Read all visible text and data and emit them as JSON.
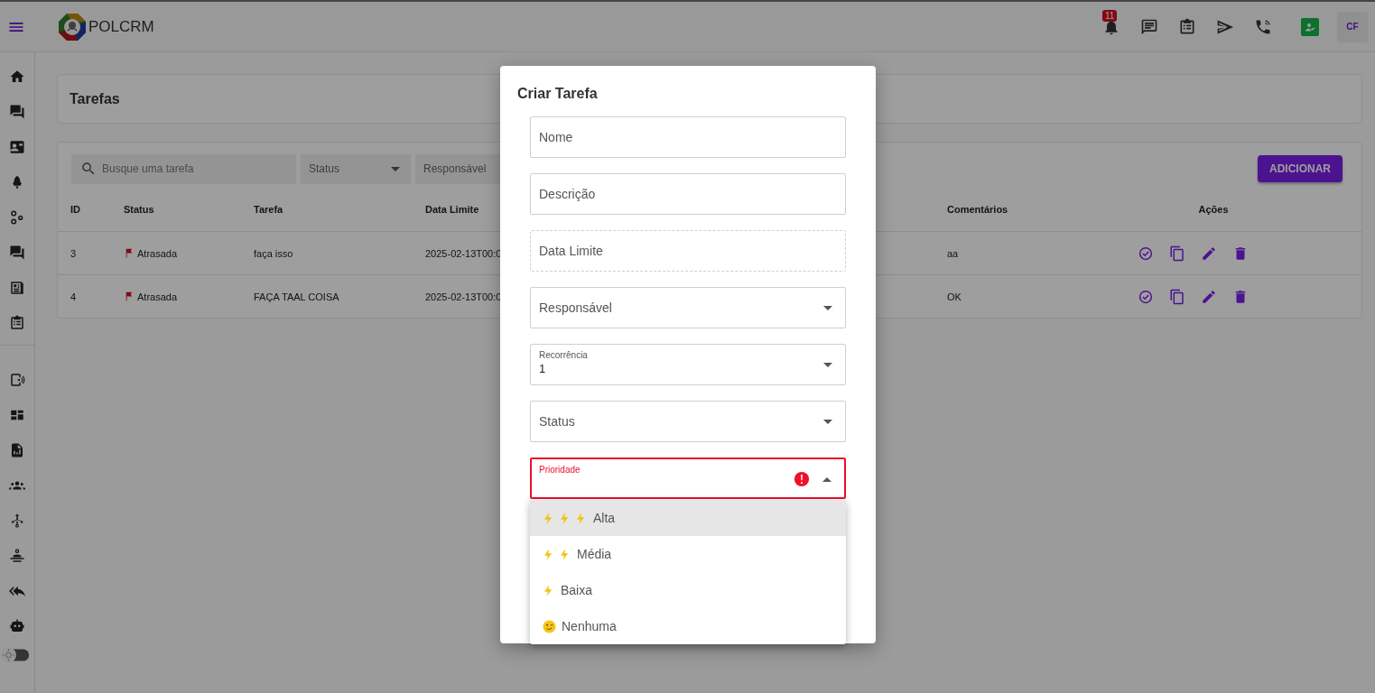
{
  "topbar": {
    "brand": "POL**CRM**",
    "notification_count": "11",
    "avatar_initials": "CF"
  },
  "page": {
    "title": "Tarefas"
  },
  "filters": {
    "search_placeholder": "Busque uma tarefa",
    "status_placeholder": "Status",
    "responsible_placeholder": "Responsável",
    "add_button": "ADICIONAR"
  },
  "table": {
    "columns": [
      "ID",
      "Status",
      "Tarefa",
      "Data Limite",
      "Comentários",
      "Ações"
    ],
    "rows": [
      {
        "id": "3",
        "status": "Atrasada",
        "task": "faça isso",
        "due": "2025-02-13T00:0",
        "comments": "aa"
      },
      {
        "id": "4",
        "status": "Atrasada",
        "task": "FAÇA TAAL COISA",
        "due": "2025-02-13T00:0",
        "comments": "OK"
      }
    ]
  },
  "dialog": {
    "title": "Criar Tarefa",
    "fields": [
      {
        "kind": "text",
        "label": "Nome",
        "error": false,
        "expanded": false
      },
      {
        "kind": "text",
        "label": "Descrição",
        "error": false,
        "expanded": false
      },
      {
        "kind": "date",
        "label": "Data Limite",
        "error": false,
        "expanded": false
      },
      {
        "kind": "select",
        "label": "Responsável",
        "error": false,
        "expanded": false
      },
      {
        "kind": "select",
        "label": "Recorrência",
        "value": "1",
        "error": false,
        "expanded": false
      },
      {
        "kind": "select",
        "label": "Status",
        "error": false,
        "expanded": false
      },
      {
        "kind": "select",
        "label": "Prioridade",
        "error": true,
        "expanded": true
      }
    ],
    "priority_options": [
      {
        "kind": "high",
        "label": "Alta",
        "selected": true
      },
      {
        "kind": "medium",
        "label": "Média",
        "selected": false
      },
      {
        "kind": "low",
        "label": "Baixa",
        "selected": false
      },
      {
        "kind": "none",
        "label": "Nenhuma",
        "selected": false
      }
    ]
  }
}
